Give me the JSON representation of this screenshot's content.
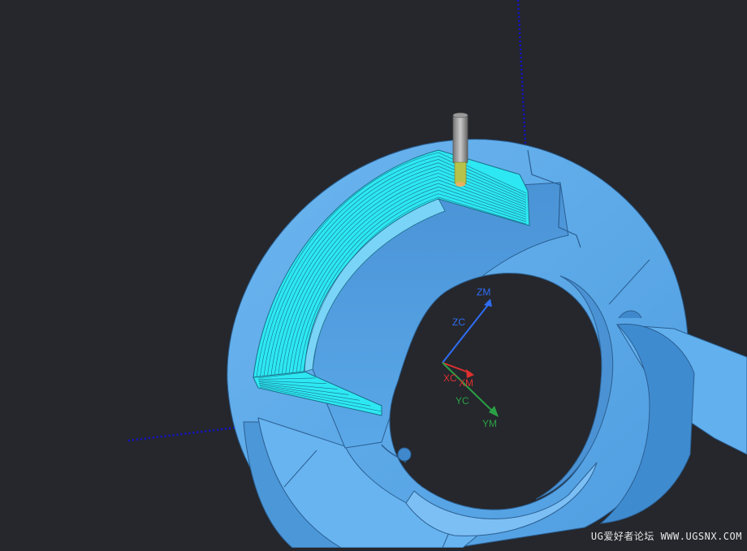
{
  "viewport": {
    "background": "#25272c",
    "part_color": "#5aa9ea",
    "highlight_color": "#2de8f2",
    "toolpath_color": "#1a6f8a",
    "datum_line_color": "#1010d0"
  },
  "csys": {
    "zm_label": "ZM",
    "zc_label": "ZC",
    "xc_label": "XC",
    "xm_label": "XM",
    "yc_label": "YC",
    "ym_label": "YM",
    "z_color": "#2f6df5",
    "x_color": "#e03030",
    "y_color": "#2aa045"
  },
  "watermark": {
    "text": "UG爱好者论坛 WWW.UGSNX.COM"
  }
}
